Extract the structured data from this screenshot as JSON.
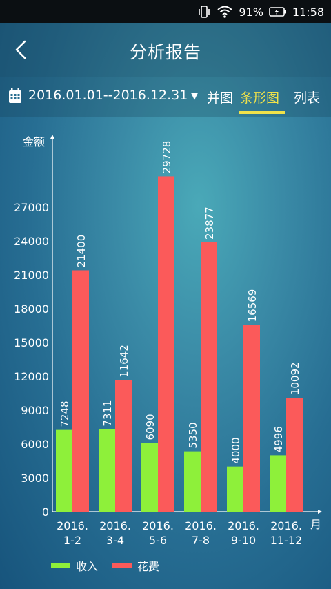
{
  "status_bar": {
    "battery": "91%",
    "time": "11:58"
  },
  "header": {
    "title": "分析报告"
  },
  "filter": {
    "date_range": "2016.01.01--2016.12.31",
    "tabs": [
      "并图",
      "条形图",
      "列表"
    ]
  },
  "colors": {
    "income": "#8ef03a",
    "expense": "#fb5a5a",
    "active_tab": "#f0e24a"
  },
  "chart_data": {
    "type": "bar",
    "ylabel": "金额",
    "xlabel": "月",
    "ylim": [
      0,
      30000
    ],
    "yticks": [
      0,
      3000,
      6000,
      9000,
      12000,
      15000,
      18000,
      21000,
      24000,
      27000
    ],
    "categories": [
      [
        "2016.",
        "1-2"
      ],
      [
        "2016.",
        "3-4"
      ],
      [
        "2016.",
        "5-6"
      ],
      [
        "2016.",
        "7-8"
      ],
      [
        "2016.",
        "9-10"
      ],
      [
        "2016.",
        "11-12"
      ]
    ],
    "series": [
      {
        "name": "收入",
        "values": [
          7248,
          7311,
          6090,
          5350,
          4000,
          4996
        ]
      },
      {
        "name": "花费",
        "values": [
          21400,
          11642,
          29728,
          23877,
          16569,
          10092
        ]
      }
    ],
    "legend_position": "bottom-left",
    "grid": false
  }
}
